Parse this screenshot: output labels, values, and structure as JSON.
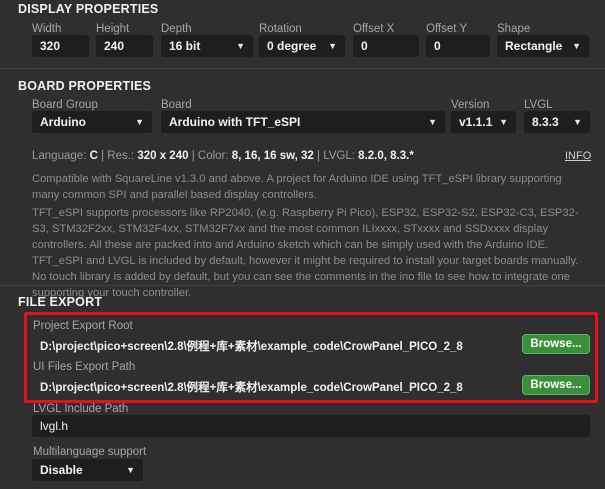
{
  "display": {
    "title": "DISPLAY PROPERTIES",
    "width_label": "Width",
    "width_value": "320",
    "height_label": "Height",
    "height_value": "240",
    "depth_label": "Depth",
    "depth_value": "16 bit",
    "rotation_label": "Rotation",
    "rotation_value": "0 degree",
    "offx_label": "Offset X",
    "offx_value": "0",
    "offy_label": "Offset Y",
    "offy_value": "0",
    "shape_label": "Shape",
    "shape_value": "Rectangle"
  },
  "board": {
    "title": "BOARD PROPERTIES",
    "group_label": "Board Group",
    "group_value": "Arduino",
    "board_label": "Board",
    "board_value": "Arduino with TFT_eSPI",
    "version_label": "Version",
    "version_value": "v1.1.1",
    "lvgl_label": "LVGL",
    "lvgl_value": "8.3.3",
    "info": {
      "language_label": "Language:",
      "language_value": "C",
      "res_label": "| Res.:",
      "res_value": "320 x 240",
      "color_label": "| Color:",
      "color_value": "8, 16, 16 sw, 32",
      "lvgl_label": "| LVGL:",
      "lvgl_value": "8.2.0, 8.3.*",
      "link": "INFO"
    },
    "description1": "Compatible with SquareLine v1.3.0 and above. A project for Arduino IDE using TFT_eSPI library supporting many common SPI and parallel based display controllers.",
    "description2": "TFT_eSPI supports processors like RP2040, (e.g. Raspberry Pi Pico), ESP32, ESP32-S2, ESP32-C3, ESP32-S3, STM32F2xx, STM32F4xx, STM32F7xx and the most common ILIxxxx, STxxxx and SSDxxxx display controllers. All these are packed into and Arduino sketch which can be simply used with the Arduino IDE. TFT_eSPI and LVGL is included by default, however it might be required to install your target boards manually.  No touch library is added by default, but you can see the comments in the ino file to see how to integrate one supporting your touch controller."
  },
  "export": {
    "title": "FILE EXPORT",
    "root_label": "Project Export Root",
    "root_path": "D:\\project\\pico+screen\\2.8\\例程+库+素材\\example_code\\CrowPanel_PICO_2_8",
    "ui_label": "UI Files Export Path",
    "ui_path": "D:\\project\\pico+screen\\2.8\\例程+库+素材\\example_code\\CrowPanel_PICO_2_8",
    "browse_label": "Browse...",
    "lvgl_include_label": "LVGL Include Path",
    "lvgl_include_value": "lvgl.h",
    "multilang_label": "Multilanguage support",
    "multilang_value": "Disable"
  },
  "colors": {
    "accent_green": "#3b8f3b",
    "highlight_red": "#e0141c"
  },
  "icons": {
    "dropdown": "chevron-down-icon"
  }
}
